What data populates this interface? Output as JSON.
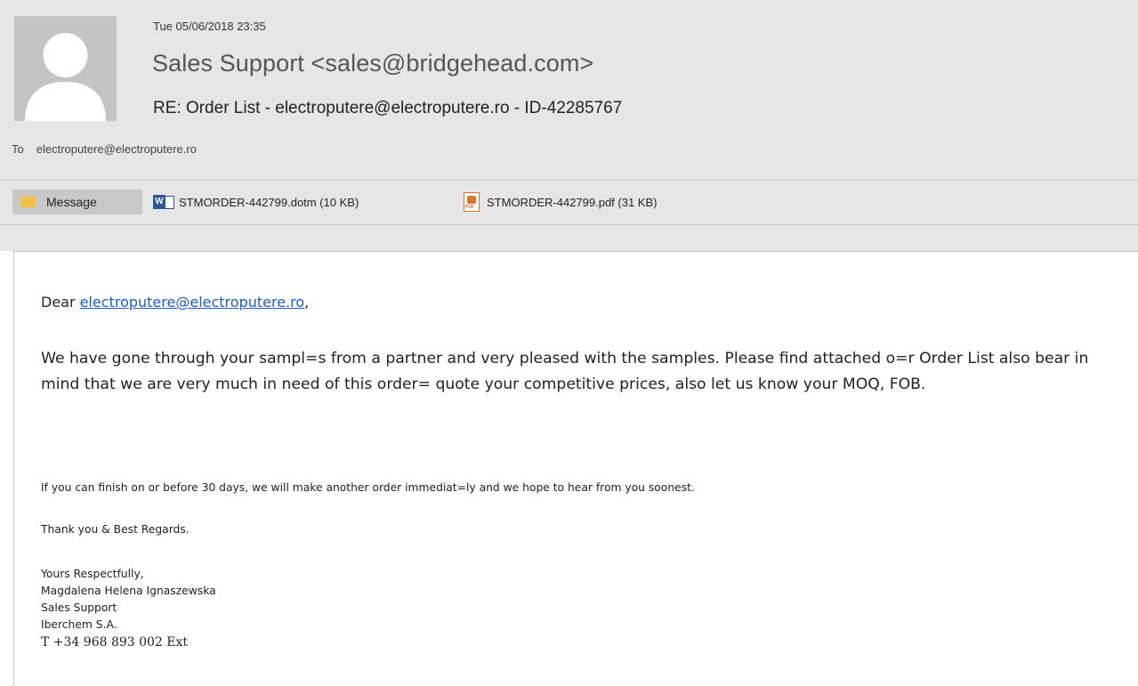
{
  "email": {
    "date": "Tue 05/06/2018 23:35",
    "sender": "Sales Support <sales@bridgehead.com>",
    "subject": "RE: Order List - electroputere@electroputere.ro - ID-42285767",
    "to_label": "To",
    "to_value": "electroputere@electroputere.ro"
  },
  "attachments": {
    "message_tab": "Message",
    "items": [
      {
        "name": "STMORDER-442799.dotm (10 KB)",
        "icon": "word-doc-icon"
      },
      {
        "name": "STMORDER-442799.pdf (31 KB)",
        "icon": "pdf-icon"
      }
    ]
  },
  "body": {
    "greeting_prefix": "Dear ",
    "greeting_link": "electroputere@electroputere.ro",
    "greeting_suffix": ",",
    "para1": "We have gone through your sampl=s from a partner and very pleased with the samples. Please find attached o=r Order List also bear in mind that we are very much in need of this order= quote your competitive prices, also let us know your MOQ, FOB.",
    "para2": "If you can finish on or before 30 days, we will make another order immediat=ly and we hope to hear from you soonest.",
    "para3": "Thank you & Best Regards.",
    "signature": [
      "Yours Respectfully,",
      "Magdalena Helena Ignaszewska",
      "Sales Support",
      "Iberchem S.A."
    ],
    "phone": "T +34 968 893 002 Ext"
  },
  "colors": {
    "header_bg": "#e6e6e6",
    "avatar_bg": "#c4c4c4",
    "link": "#1a5fc4",
    "message_tab_bg": "#c8c8c8"
  }
}
